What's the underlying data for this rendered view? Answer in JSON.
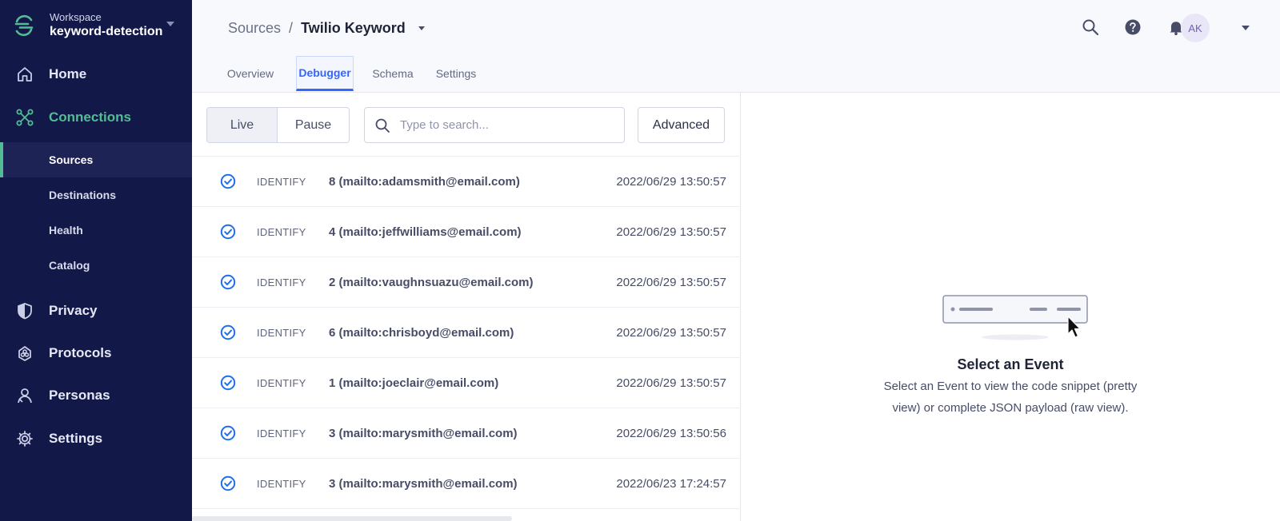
{
  "workspace": {
    "label": "Workspace",
    "name": "keyword-detection"
  },
  "nav": {
    "home": "Home",
    "connections": "Connections",
    "sub": {
      "sources": "Sources",
      "destinations": "Destinations",
      "health": "Health",
      "catalog": "Catalog"
    },
    "privacy": "Privacy",
    "protocols": "Protocols",
    "personas": "Personas",
    "settings": "Settings"
  },
  "breadcrumb": {
    "parent": "Sources",
    "separator": "/",
    "current": "Twilio Keyword"
  },
  "header": {
    "avatar_initials": "AK"
  },
  "tabs": [
    "Overview",
    "Debugger",
    "Schema",
    "Settings"
  ],
  "toolbar": {
    "live": "Live",
    "pause": "Pause",
    "search_placeholder": "Type to search...",
    "advanced": "Advanced"
  },
  "events": [
    {
      "type": "IDENTIFY",
      "name": "8 (mailto:adamsmith@email.com)",
      "time": "2022/06/29 13:50:57"
    },
    {
      "type": "IDENTIFY",
      "name": "4 (mailto:jeffwilliams@email.com)",
      "time": "2022/06/29 13:50:57"
    },
    {
      "type": "IDENTIFY",
      "name": "2 (mailto:vaughnsuazu@email.com)",
      "time": "2022/06/29 13:50:57"
    },
    {
      "type": "IDENTIFY",
      "name": "6 (mailto:chrisboyd@email.com)",
      "time": "2022/06/29 13:50:57"
    },
    {
      "type": "IDENTIFY",
      "name": "1 (mailto:joeclair@email.com)",
      "time": "2022/06/29 13:50:57"
    },
    {
      "type": "IDENTIFY",
      "name": "3 (mailto:marysmith@email.com)",
      "time": "2022/06/29 13:50:56"
    },
    {
      "type": "IDENTIFY",
      "name": "3 (mailto:marysmith@email.com)",
      "time": "2022/06/23 17:24:57"
    }
  ],
  "detail": {
    "title": "Select an Event",
    "description": "Select an Event to view the code snippet (pretty view) or complete JSON payload (raw view)."
  },
  "colors": {
    "sidebar": "#121848",
    "accent_green": "#52bd94",
    "accent_blue": "#3366ff",
    "check_blue": "#1f6feb"
  },
  "icons": {
    "logo": "segment-logo-icon",
    "home": "home-icon",
    "connections": "connections-icon",
    "privacy": "shield-icon",
    "protocols": "protocols-icon",
    "personas": "person-icon",
    "settings": "gear-icon",
    "search": "search-icon",
    "help": "help-icon",
    "notifications": "bell-icon",
    "check": "check-circle-icon"
  }
}
